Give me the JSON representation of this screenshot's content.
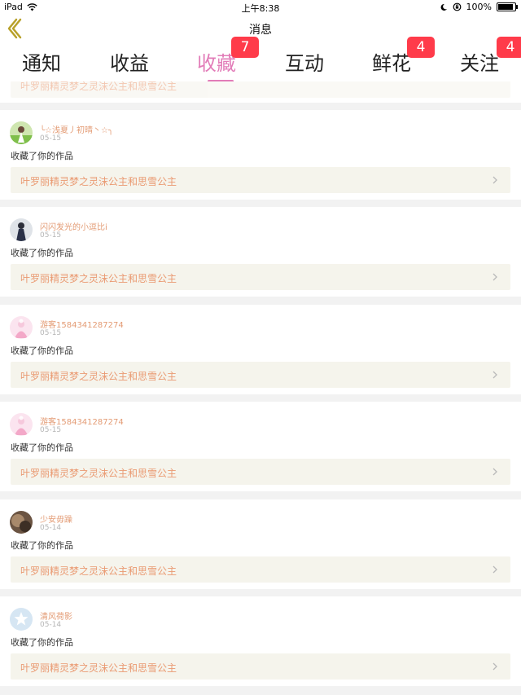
{
  "status_bar": {
    "device": "iPad",
    "time": "上午8:38",
    "battery": "100%",
    "battery_level": 1.0
  },
  "nav": {
    "title": "消息"
  },
  "tabs": [
    {
      "label": "通知"
    },
    {
      "label": "收益"
    },
    {
      "label": "收藏",
      "badge": "7",
      "active": true
    },
    {
      "label": "互动"
    },
    {
      "label": "鲜花",
      "badge": "4"
    },
    {
      "label": "关注",
      "badge": "4"
    }
  ],
  "list": {
    "partial_top_title": "叶罗丽精灵梦之灵沫公主和思雪公主",
    "items": [
      {
        "username": "╰☆浅夏丿初晴丶☆╮",
        "date": "05-15",
        "action": "收藏了你的作品",
        "work": "叶罗丽精灵梦之灵沫公主和思雪公主",
        "avatar": "green-girl-avatar"
      },
      {
        "username": "闪闪发光的小逗比i",
        "date": "05-15",
        "action": "收藏了你的作品",
        "work": "叶罗丽精灵梦之灵沫公主和思雪公主",
        "avatar": "dark-figure-avatar"
      },
      {
        "username": "游客1584341287274",
        "date": "05-15",
        "action": "收藏了你的作品",
        "work": "叶罗丽精灵梦之灵沫公主和思雪公主",
        "avatar": "pink-princess-avatar"
      },
      {
        "username": "游客1584341287274",
        "date": "05-15",
        "action": "收藏了你的作品",
        "work": "叶罗丽精灵梦之灵沫公主和思雪公主",
        "avatar": "pink-princess-avatar"
      },
      {
        "username": "少安毋躁",
        "date": "05-14",
        "action": "收藏了你的作品",
        "work": "叶罗丽精灵梦之灵沫公主和思雪公主",
        "avatar": "brown-photo-avatar"
      },
      {
        "username": "清风荷影",
        "date": "05-14",
        "action": "收藏了你的作品",
        "work": "叶罗丽精灵梦之灵沫公主和思雪公主",
        "avatar": "default-star-avatar"
      }
    ]
  }
}
